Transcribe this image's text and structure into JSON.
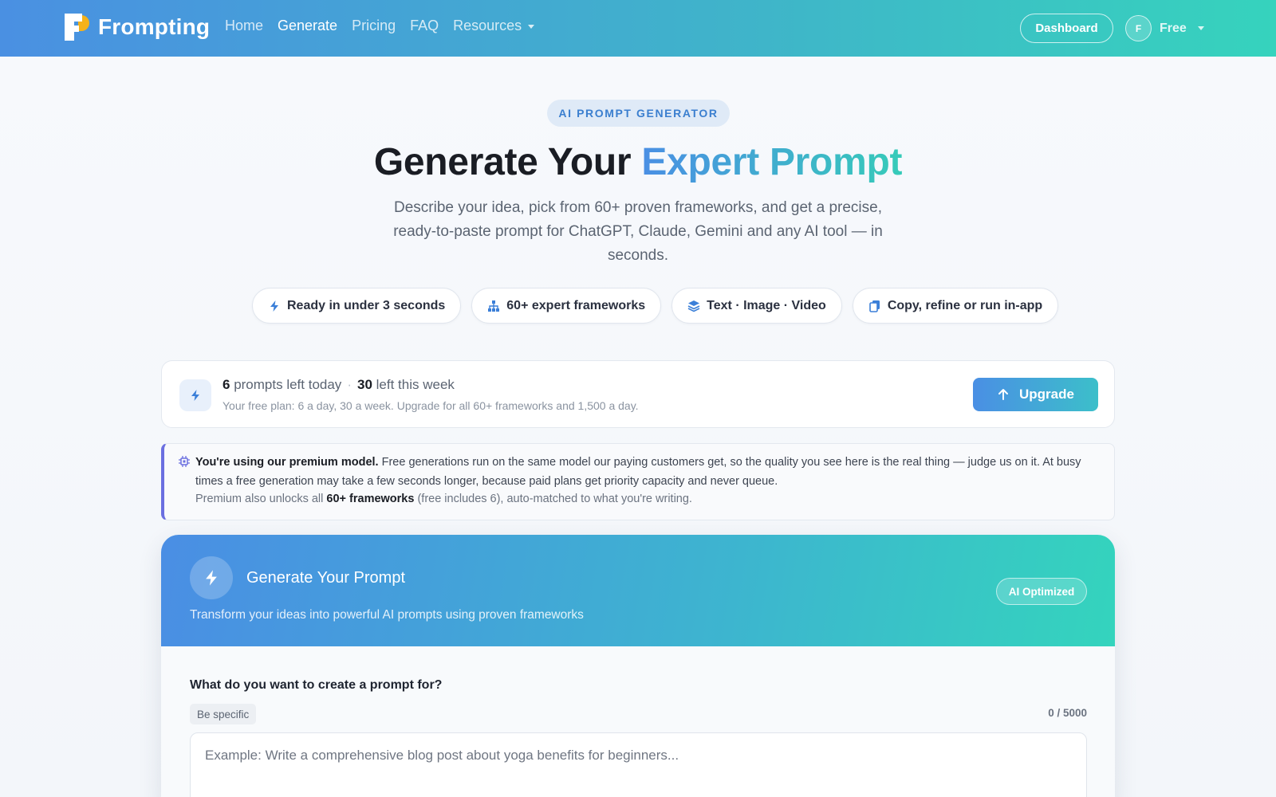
{
  "nav": {
    "brand": "Frompting",
    "links": [
      "Home",
      "Generate",
      "Pricing",
      "FAQ",
      "Resources"
    ],
    "dashboard": "Dashboard",
    "avatar_initial": "F",
    "plan": "Free"
  },
  "hero": {
    "eyebrow": "AI PROMPT GENERATOR",
    "title_plain": "Generate Your ",
    "title_accent": "Expert Prompt",
    "subtitle": "Describe your idea, pick from 60+ proven frameworks, and get a precise, ready-to-paste prompt for ChatGPT, Claude, Gemini and any AI tool — in seconds.",
    "chips": [
      {
        "label": "Ready in under 3 seconds",
        "icon": "bolt-icon"
      },
      {
        "label": "60+ expert frameworks",
        "icon": "sitemap-icon"
      },
      {
        "label": "Text · Image · Video",
        "icon": "layers-icon"
      },
      {
        "label": "Copy, refine or run in-app",
        "icon": "copy-icon"
      }
    ]
  },
  "quota": {
    "today_count": "6",
    "today_label": " prompts left today",
    "week_count": "30",
    "week_label": " left this week",
    "detail": "Your free plan: 6 a day, 30 a week. Upgrade for all 60+ frameworks and 1,500 a day.",
    "upgrade": "Upgrade"
  },
  "notice": {
    "bold": "You're using our premium model.",
    "text": " Free generations run on the same model our paying customers get, so the quality you see here is the real thing — judge us on it. At busy times a free generation may take a few seconds longer, because paid plans get priority capacity and never queue.",
    "line2_pre": "Premium also unlocks all ",
    "line2_bold": "60+ frameworks",
    "line2_post": " (free includes 6), auto-matched to what you're writing."
  },
  "generator": {
    "title": "Generate Your Prompt",
    "subtitle": "Transform your ideas into powerful AI prompts using proven frameworks",
    "badge": "AI Optimized",
    "field_label": "What do you want to create a prompt for?",
    "hint": "Be specific",
    "char_count": "0 / 5000",
    "value": "",
    "placeholder": "Example: Write a comprehensive blog post about yoga benefits for beginners..."
  },
  "colors": {
    "accent_blue": "#4a8fe4",
    "accent_teal": "#36cbb9",
    "logo_yellow": "#f5b21a",
    "notice_border": "#6b6fe0"
  }
}
